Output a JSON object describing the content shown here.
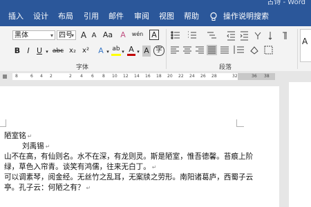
{
  "window": {
    "title": "古诗 - Word"
  },
  "tabs": [
    "插入",
    "设计",
    "布局",
    "引用",
    "邮件",
    "审阅",
    "视图",
    "帮助"
  ],
  "tell_me": {
    "label": "操作说明搜索",
    "icon": "lightbulb-icon"
  },
  "font": {
    "name": "黑体",
    "size": "四号"
  },
  "font_group_label": "字体",
  "paragraph_group_label": "段落",
  "ribbon_glyphs": {
    "grow": "A",
    "shrink": "A",
    "case": "Aa",
    "clear": "A",
    "phonetic": "wén",
    "border_char": "A",
    "bold": "B",
    "italic": "I",
    "underline": "U",
    "strike": "abc",
    "sub": "x₂",
    "sup": "x²",
    "effects": "A",
    "highlight": "ab",
    "font_color": "A",
    "shading": "A",
    "enclose": "字"
  },
  "ruler": {
    "ticks": [
      "8",
      "6",
      "4",
      "2",
      "2",
      "4",
      "6",
      "8",
      "10",
      "12",
      "14",
      "16",
      "18",
      "20",
      "22",
      "24",
      "26",
      "28",
      "32",
      "36",
      "38"
    ]
  },
  "document": {
    "title": "陋室铭",
    "author": "刘禹锡",
    "lines": [
      "山不在高，有仙则名。水不在深，有龙则灵。斯是陋室，惟吾德馨。苔痕上阶",
      "绿，草色入帘青。谈笑有鸿儒，往来无白丁。",
      "可以调素琴，阅金经。无丝竹之乱耳，无案牍之劳形。南阳诸葛庐，西蜀子云",
      "亭。孔子云：何陋之有？"
    ],
    "paragraph_mark": "↵"
  },
  "colors": {
    "ribbon_blue": "#2b579a",
    "font_color_red": "#c00000",
    "highlight_yellow": "#ffff00"
  }
}
